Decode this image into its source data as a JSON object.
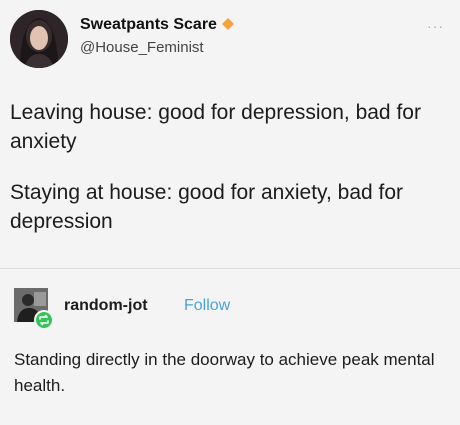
{
  "tweet": {
    "display_name": "Sweatpants Scare",
    "handle": "@House_Feminist",
    "more_label": "···",
    "lines": [
      "Leaving house: good for depression, bad for anxiety",
      "Staying at house: good for anxiety, bad for depression"
    ],
    "badge_color": "#f2a43a"
  },
  "post": {
    "username": "random-jot",
    "follow_label": "Follow",
    "follow_color": "#4aa3d8",
    "text": "Standing directly in the doorway to achieve peak mental health.",
    "reblog_color": "#35c35a"
  }
}
